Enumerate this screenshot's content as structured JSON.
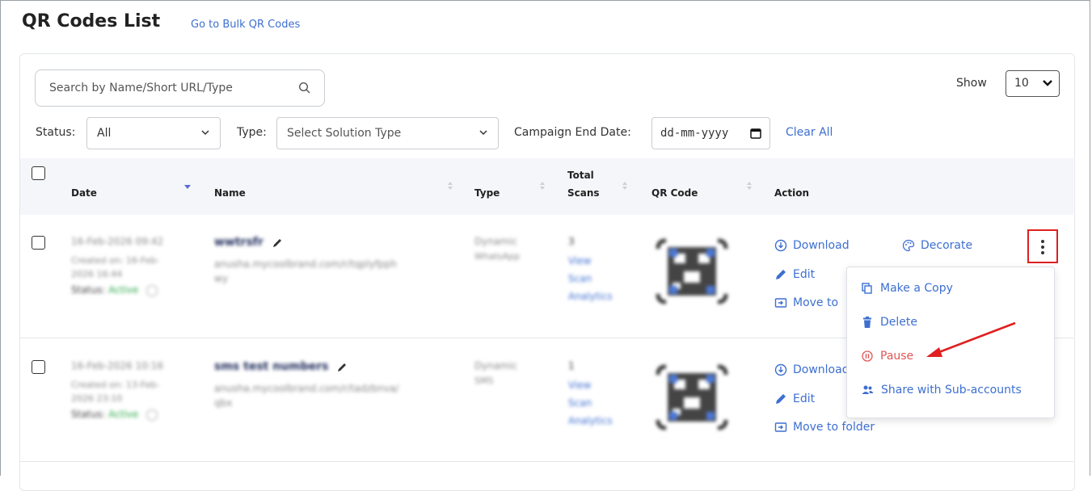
{
  "header": {
    "title": "QR Codes List",
    "bulk_link": "Go to Bulk QR Codes"
  },
  "search": {
    "placeholder": "Search by Name/Short URL/Type"
  },
  "show": {
    "label": "Show",
    "value": "10"
  },
  "filters": {
    "status_label": "Status:",
    "status_value": "All",
    "type_label": "Type:",
    "type_value": "Select Solution Type",
    "campaign_label": "Campaign End Date:",
    "campaign_value": "dd-mm-yyyy",
    "clear_all": "Clear All"
  },
  "table": {
    "columns": [
      "Date",
      "Name",
      "Type",
      "Total Scans",
      "QR Code",
      "Action"
    ],
    "columns_split": {
      "total1": "Total",
      "total2": "Scans"
    },
    "rows": [
      {
        "date": "16-Feb-2026 09:42",
        "created": "Created on: 16-Feb-2026 16:44",
        "created_l1": "Created on: 16-Feb-",
        "created_l2": "2026 16:44",
        "status_label": "Status:",
        "status_value": "Active",
        "name": "wwtrsfr",
        "url_l1": "anusha.mycoolbrand.com/r/tqplyfpph",
        "url_l2": "wy",
        "type": "Dynamic",
        "subtype": "WhatsApp",
        "scans": "3",
        "view1": "View",
        "view2": "Scan",
        "view3": "Analytics"
      },
      {
        "date": "16-Feb-2026 10:16",
        "created_l1": "Created on: 13-Feb-",
        "created_l2": "2026 23:10",
        "status_label": "Status:",
        "status_value": "Active",
        "name": "sms test numbers",
        "url_l1": "anusha.mycoolbrand.com/r/tadzbnva/",
        "url_l2": "qbx",
        "type": "Dynamic",
        "subtype": "SMS",
        "scans": "1",
        "view1": "View",
        "view2": "Scan",
        "view3": "Analytics"
      }
    ]
  },
  "actions": {
    "download": "Download",
    "decorate": "Decorate",
    "edit": "Edit",
    "move_to": "Move to",
    "move_to_folder": "Move to folder"
  },
  "menu": {
    "make_copy": "Make a Copy",
    "delete": "Delete",
    "pause": "Pause",
    "share": "Share with Sub-accounts"
  },
  "colors": {
    "link": "#3d6fd1",
    "highlight": "#e02020",
    "active": "#2ea84a",
    "pause": "#e05555"
  }
}
